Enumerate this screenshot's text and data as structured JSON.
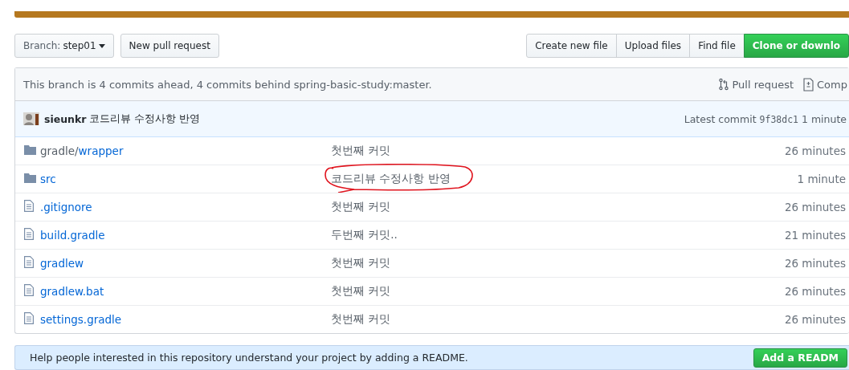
{
  "toolbar": {
    "branch_label": "Branch:",
    "branch": "step01",
    "new_pull_request": "New pull request",
    "actions": [
      "Create new file",
      "Upload files",
      "Find file"
    ],
    "clone": "Clone or downlo"
  },
  "branch_info": {
    "text": "This branch is 4 commits ahead, 4 commits behind spring-basic-study:master.",
    "links": [
      "Pull request",
      "Comp"
    ]
  },
  "latest_commit": {
    "author": "sieunkr",
    "message": "코드리뷰 수정사항 반영",
    "label": "Latest commit",
    "sha": "9f38dc1",
    "age": "1 minute"
  },
  "files": [
    {
      "kind": "folder",
      "name": "gradle/",
      "name_link": "wrapper",
      "message": "첫번째 커밋",
      "age": "26 minutes",
      "circled": false
    },
    {
      "kind": "folder",
      "name_link": "src",
      "message": "코드리뷰 수정사항 반영",
      "age": "1 minute",
      "circled": true
    },
    {
      "kind": "file",
      "name_link": ".gitignore",
      "message": "첫번째 커밋",
      "age": "26 minutes",
      "circled": false
    },
    {
      "kind": "file",
      "name_link": "build.gradle",
      "message": "두번째 커밋..",
      "age": "21 minutes",
      "circled": false
    },
    {
      "kind": "file",
      "name_link": "gradlew",
      "message": "첫번째 커밋",
      "age": "26 minutes",
      "circled": false
    },
    {
      "kind": "file",
      "name_link": "gradlew.bat",
      "message": "첫번째 커밋",
      "age": "26 minutes",
      "circled": false
    },
    {
      "kind": "file",
      "name_link": "settings.gradle",
      "message": "첫번째 커밋",
      "age": "26 minutes",
      "circled": false
    }
  ],
  "readme": {
    "text": "Help people interested in this repository understand your project by adding a README.",
    "button": "Add a READM"
  }
}
